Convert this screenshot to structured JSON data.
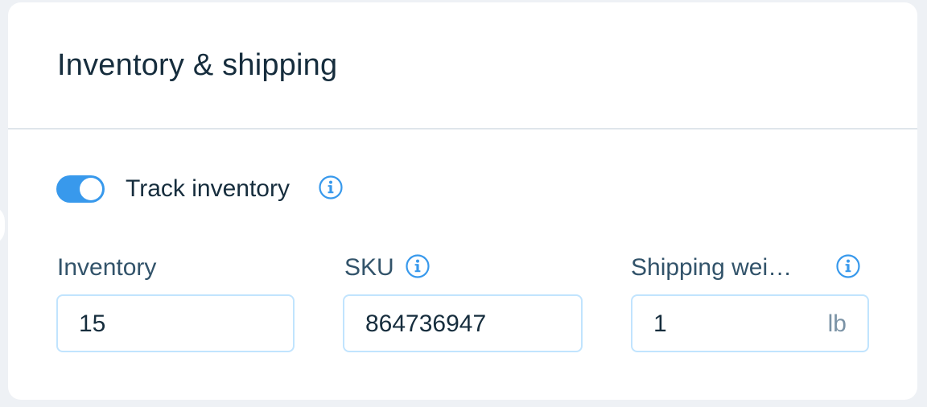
{
  "card": {
    "title": "Inventory & shipping"
  },
  "track_inventory": {
    "label": "Track inventory",
    "enabled": true
  },
  "fields": {
    "inventory": {
      "label": "Inventory",
      "value": "15"
    },
    "sku": {
      "label": "SKU",
      "value": "864736947"
    },
    "shipping_weight": {
      "label": "Shipping wei…",
      "value": "1",
      "unit": "lb"
    }
  },
  "colors": {
    "accent": "#3899ec",
    "title_text": "#162d3d",
    "label_text": "#32536a",
    "input_border": "#c1e4fe",
    "divider": "#dfe5eb"
  },
  "icons": {
    "info": "info-icon"
  }
}
